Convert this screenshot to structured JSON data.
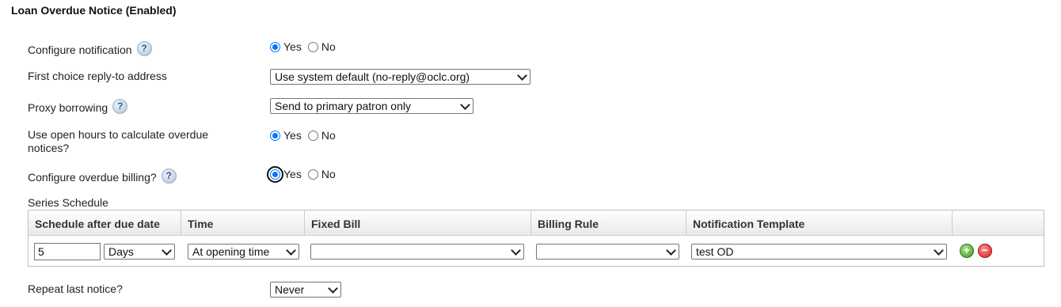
{
  "page": {
    "title": "Loan Overdue Notice (Enabled)"
  },
  "fields": {
    "configure_notification": {
      "label": "Configure notification",
      "help": "?",
      "options": [
        "Yes",
        "No"
      ],
      "selected": "Yes"
    },
    "reply_to": {
      "label": "First choice reply-to address",
      "value": "Use system default (no-reply@oclc.org)"
    },
    "proxy_borrowing": {
      "label": "Proxy borrowing",
      "help": "?",
      "value": "Send to primary patron only"
    },
    "open_hours": {
      "label_line1": "Use open hours to calculate overdue",
      "label_line2": "notices?",
      "options": [
        "Yes",
        "No"
      ],
      "selected": "Yes"
    },
    "overdue_billing": {
      "label": "Configure overdue billing?",
      "help": "?",
      "options": [
        "Yes",
        "No"
      ],
      "selected": "Yes"
    },
    "repeat_last_notice": {
      "label": "Repeat last notice?",
      "value": "Never"
    }
  },
  "series_schedule": {
    "label": "Series Schedule",
    "columns": [
      "Schedule after due date",
      "Time",
      "Fixed Bill",
      "Billing Rule",
      "Notification Template"
    ],
    "rows": [
      {
        "after_due_value": "5",
        "after_due_unit": "Days",
        "time": "At opening time",
        "fixed_bill": "",
        "billing_rule": "",
        "template": "test OD",
        "add_icon": "+",
        "remove_icon": "−"
      }
    ]
  },
  "colors": {
    "radio_checked": "#0075ff",
    "add_icon": "#3c9a1e",
    "remove_icon": "#d42020"
  }
}
